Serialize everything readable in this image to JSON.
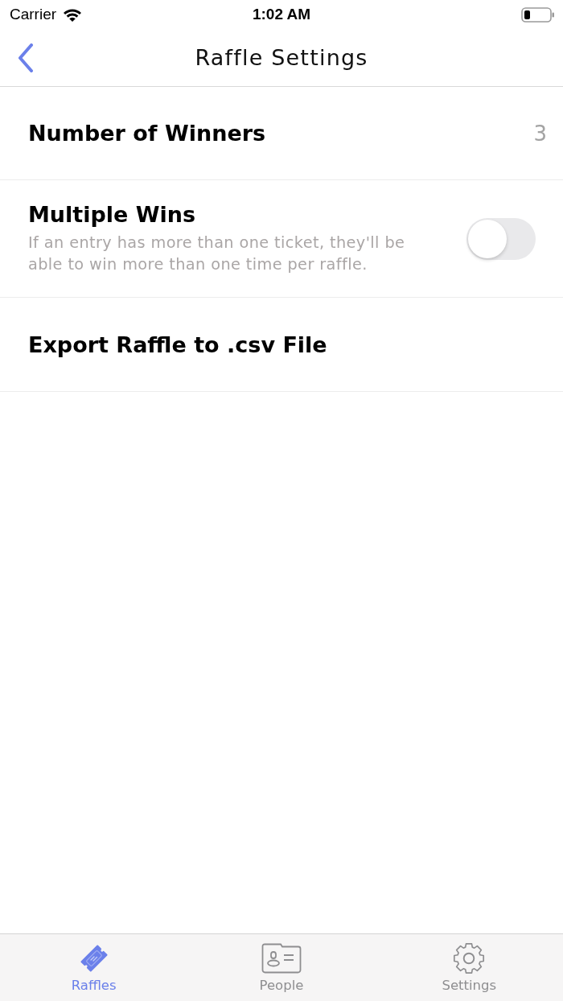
{
  "status_bar": {
    "carrier": "Carrier",
    "time": "1:02 AM"
  },
  "nav_bar": {
    "title": "Raffle Settings"
  },
  "settings": [
    {
      "kind": "value",
      "title": "Number of Winners",
      "value": "3"
    },
    {
      "kind": "toggle",
      "title": "Multiple Wins",
      "description": "If an entry has more than one ticket, they'll be able to win more than one time per raffle.",
      "on": false
    },
    {
      "kind": "action",
      "title": "Export Raffle to .csv File"
    }
  ],
  "tab_bar": [
    {
      "label": "Raffles",
      "selected": true
    },
    {
      "label": "People",
      "selected": false
    },
    {
      "label": "Settings",
      "selected": false
    }
  ]
}
